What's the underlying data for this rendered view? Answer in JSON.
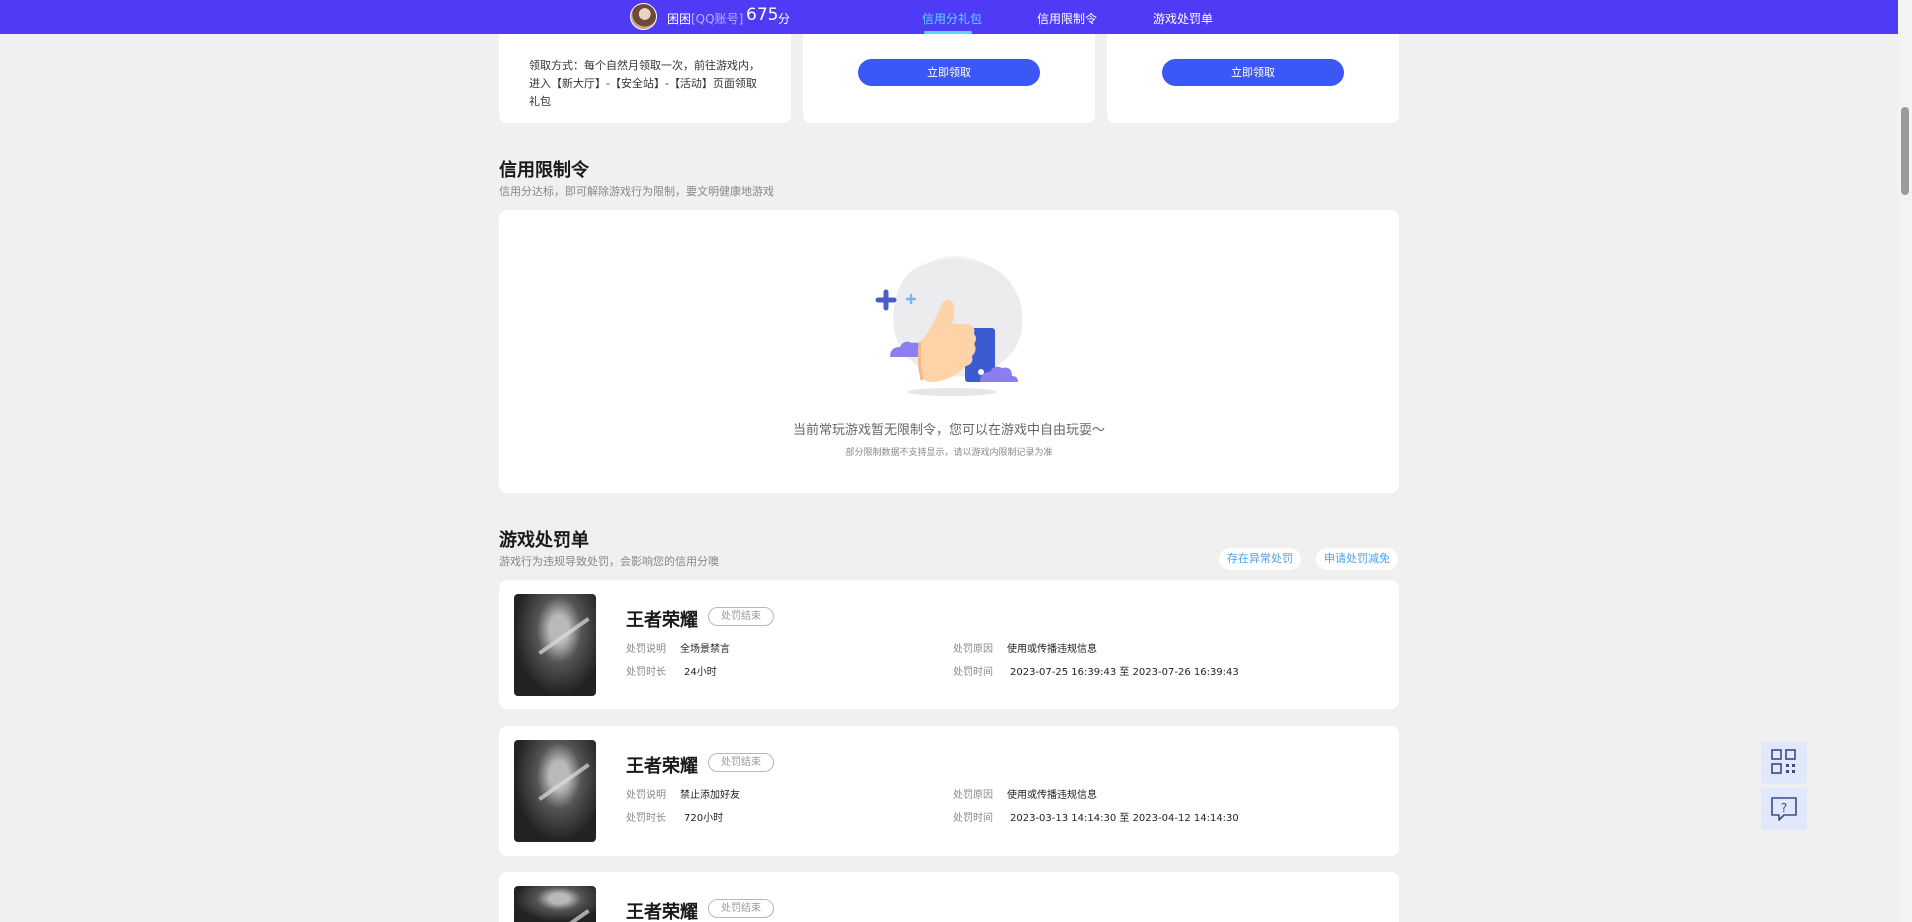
{
  "header": {
    "username": "困困",
    "account_type": "[QQ账号]",
    "score": "675",
    "score_unit": "分",
    "nav": [
      {
        "label": "信用分礼包",
        "active": true
      },
      {
        "label": "信用限制令",
        "active": false
      },
      {
        "label": "游戏处罚单",
        "active": false
      }
    ]
  },
  "gift": {
    "desc": "领取方式：每个自然月领取一次，前往游戏内，进入【新大厅】-【安全站】-【活动】页面领取礼包",
    "claim_label": "立即领取",
    "claim_label_2": "立即领取"
  },
  "restriction": {
    "title": "信用限制令",
    "subtitle": "信用分达标，即可解除游戏行为限制，要文明健康地游戏",
    "empty_main": "当前常玩游戏暂无限制令，您可以在游戏中自由玩耍～",
    "empty_sub": "部分限制数据不支持显示，请以游戏内限制记录为准"
  },
  "penalty": {
    "title": "游戏处罚单",
    "subtitle": "游戏行为违规导致处罚，会影响您的信用分噢",
    "appeal_label": "存在异常处罚",
    "reduce_label": "申请处罚减免",
    "labels": {
      "desc": "处罚说明",
      "duration": "处罚时长",
      "reason": "处罚原因",
      "time": "处罚时间"
    },
    "items": [
      {
        "game": "王者荣耀",
        "status": "处罚结束",
        "desc": "全场景禁言",
        "duration": "24小时",
        "reason": "使用或传播违规信息",
        "time": "2023-07-25 16:39:43 至 2023-07-26 16:39:43"
      },
      {
        "game": "王者荣耀",
        "status": "处罚结束",
        "desc": "禁止添加好友",
        "duration": "720小时",
        "reason": "使用或传播违规信息",
        "time": "2023-03-13 14:14:30 至 2023-04-12 14:14:30"
      },
      {
        "game": "王者荣耀",
        "status": "处罚结束"
      }
    ]
  }
}
